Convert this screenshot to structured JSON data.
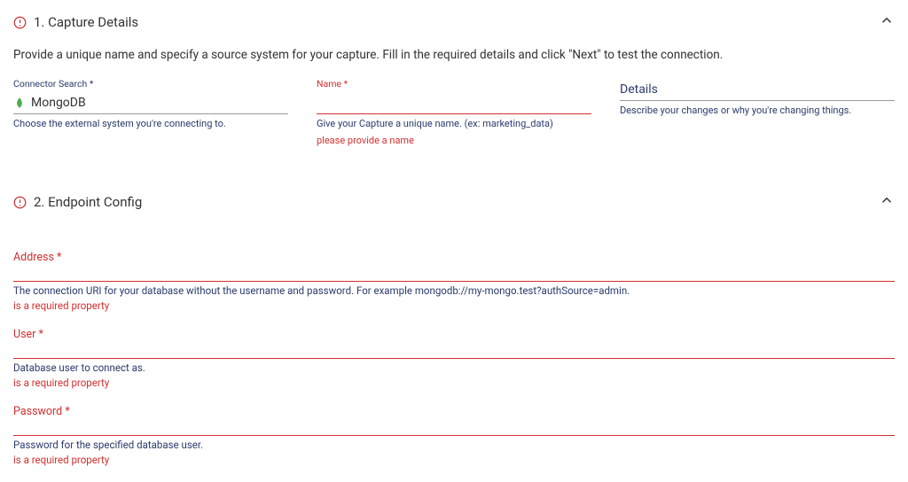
{
  "section1": {
    "title": "1. Capture Details",
    "description": "Provide a unique name and specify a source system for your capture. Fill in the required details and click \"Next\" to test the connection.",
    "connector": {
      "label": "Connector Search",
      "value": "MongoDB",
      "helper": "Choose the external system you're connecting to."
    },
    "name": {
      "label": "Name",
      "helper": "Give your Capture a unique name. (ex: marketing_data)",
      "error": "please provide a name"
    },
    "details": {
      "placeholder": "Details",
      "helper": "Describe your changes or why you're changing things."
    }
  },
  "section2": {
    "title": "2. Endpoint Config",
    "address": {
      "label": "Address",
      "helper": "The connection URI for your database without the username and password. For example mongodb://my-mongo.test?authSource=admin.",
      "error": "is a required property"
    },
    "user": {
      "label": "User",
      "helper": "Database user to connect as.",
      "error": "is a required property"
    },
    "password": {
      "label": "Password",
      "helper": "Password for the specified database user.",
      "error": "is a required property"
    }
  }
}
